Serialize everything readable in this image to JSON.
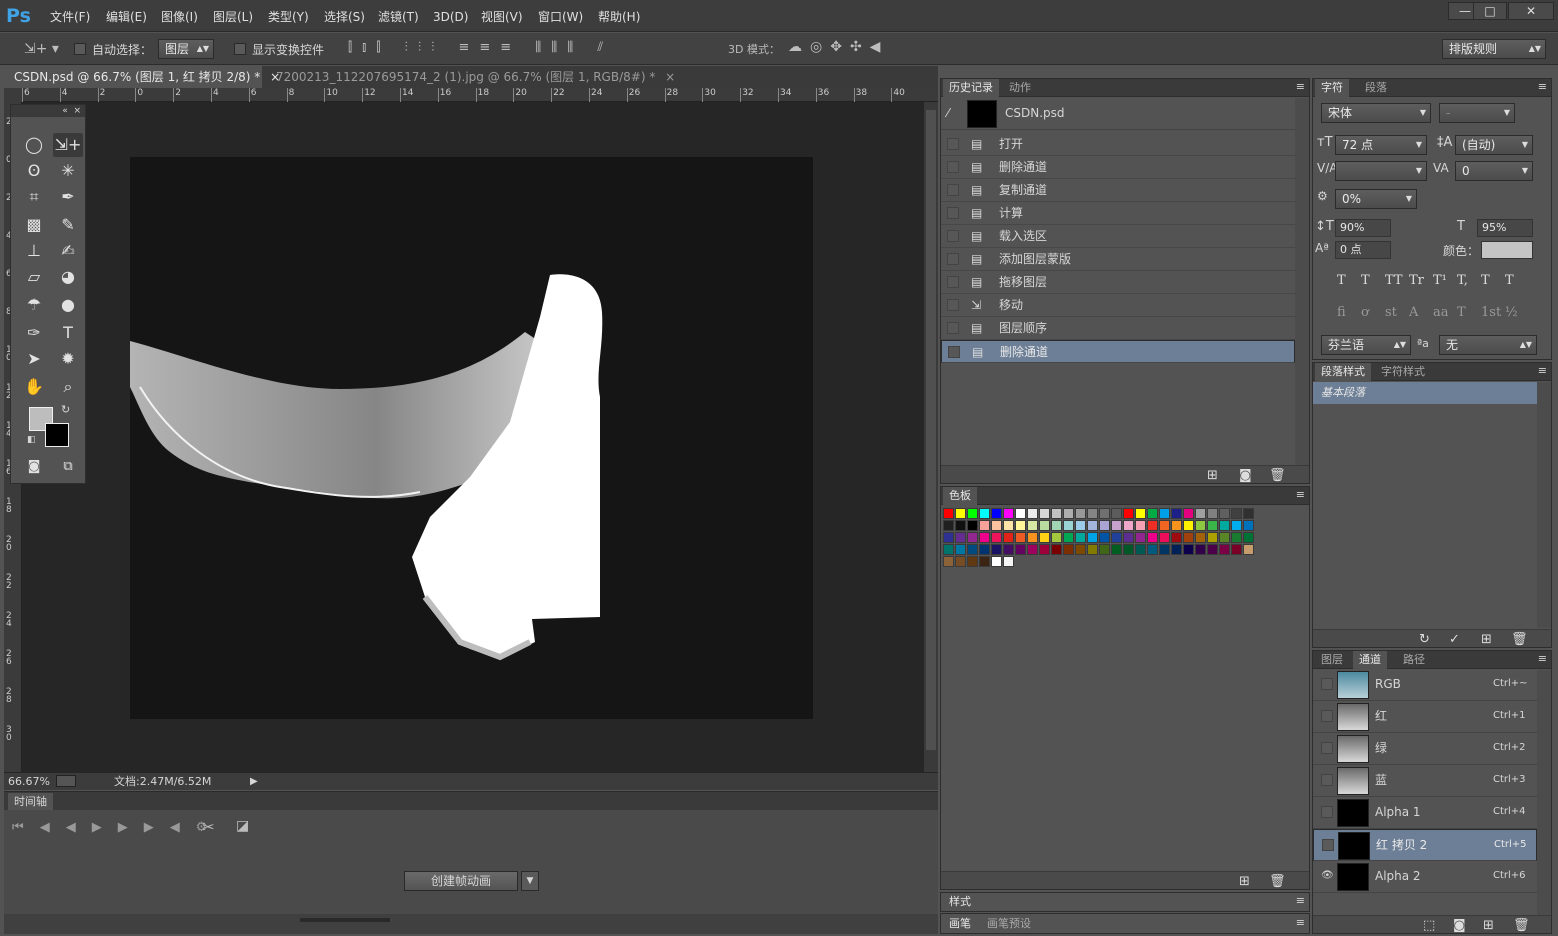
{
  "app": {
    "logo": "Ps"
  },
  "menu": [
    "文件(F)",
    "编辑(E)",
    "图像(I)",
    "图层(L)",
    "类型(Y)",
    "选择(S)",
    "滤镜(T)",
    "3D(D)",
    "视图(V)",
    "窗口(W)",
    "帮助(H)"
  ],
  "window_buttons": [
    "—",
    "□",
    "✕"
  ],
  "options": {
    "auto_select_label": "自动选择：",
    "auto_select_value": "图层",
    "show_transform_label": "显示变换控件",
    "mode_3d_label": "3D 模式：",
    "workspace": "排版规则"
  },
  "tabs": [
    {
      "label": "CSDN.psd @ 66.7% (图层 1, 红 拷贝 2/8) *"
    },
    {
      "label": "7200213_112207695174_2 (1).jpg @ 66.7% (图层 1, RGB/8#) *"
    }
  ],
  "ruler": {
    "h": [
      "6",
      "4",
      "2",
      "0",
      "2",
      "4",
      "6",
      "8",
      "10",
      "12",
      "14",
      "16",
      "18",
      "20",
      "22",
      "24",
      "26",
      "28",
      "30",
      "32",
      "34",
      "36",
      "38",
      "40"
    ],
    "v": [
      "2",
      "0",
      "2",
      "4",
      "6",
      "8",
      "1\n0",
      "1\n2",
      "1\n4",
      "1\n6",
      "1\n8",
      "2\n0",
      "2\n2",
      "2\n4",
      "2\n6",
      "2\n8",
      "3\n0"
    ]
  },
  "status": {
    "zoom": "66.67%",
    "doc": "文档:2.47M/6.52M"
  },
  "timeline": {
    "title": "时间轴",
    "create_button": "创建帧动画"
  },
  "history": {
    "tabs": [
      "历史记录",
      "动作"
    ],
    "snapshot": "CSDN.psd",
    "items": [
      "打开",
      "删除通道",
      "复制通道",
      "计算",
      "载入选区",
      "添加图层蒙版",
      "拖移图层",
      "移动",
      "图层顺序",
      "删除通道"
    ],
    "selected_index": 9
  },
  "swatches": {
    "title": "色板"
  },
  "styles": {
    "title": "样式"
  },
  "brushes": {
    "tabs": [
      "画笔",
      "画笔预设"
    ]
  },
  "character": {
    "tabs": [
      "字符",
      "段落"
    ],
    "font": "宋体",
    "style": "-",
    "size": "72 点",
    "leading": "(自动)",
    "kerning": "",
    "tracking": "0",
    "scale_pct": "0%",
    "vscale": "90%",
    "hscale": "95%",
    "baseline": "0 点",
    "color_label": "颜色：",
    "language": "芬兰语",
    "aa_label": "ªa",
    "aa_value": "无",
    "style_buttons": [
      "T",
      "T",
      "TT",
      "Tr",
      "T¹",
      "T,",
      "T",
      "T"
    ],
    "ot_buttons": [
      "fi",
      "ơ",
      "st",
      "A",
      "aa",
      "T",
      "1st",
      "½"
    ]
  },
  "para_styles": {
    "tabs": [
      "段落样式",
      "字符样式"
    ],
    "items": [
      "基本段落"
    ]
  },
  "channels": {
    "tabs": [
      "图层",
      "通道",
      "路径"
    ],
    "rows": [
      {
        "name": "RGB",
        "shortcut": "Ctrl+~"
      },
      {
        "name": "红",
        "shortcut": "Ctrl+1"
      },
      {
        "name": "绿",
        "shortcut": "Ctrl+2"
      },
      {
        "name": "蓝",
        "shortcut": "Ctrl+3"
      },
      {
        "name": "Alpha 1",
        "shortcut": "Ctrl+4"
      },
      {
        "name": "红 拷贝 2",
        "shortcut": "Ctrl+5"
      },
      {
        "name": "Alpha 2",
        "shortcut": "Ctrl+6"
      }
    ],
    "selected_index": 5,
    "visible_index": 6
  },
  "colors": {
    "swatches": [
      [
        "#ff0000",
        "#ffff00",
        "#00ff00",
        "#00ffff",
        "#0000ff",
        "#ff00ff",
        "#ffffff",
        "#ebebeb",
        "#d6d6d6",
        "#c2c2c2",
        "#adadad",
        "#999999",
        "#858585",
        "#707070",
        "#5c5c5c",
        "#ff0000",
        "#ffff00",
        "#00aa44",
        "#00a0e9",
        "#1d2088",
        "#e4007f",
        "#a0a0a0",
        "#808080",
        "#606060",
        "#404040",
        "#303030"
      ],
      [
        "#202020",
        "#101010",
        "#000000",
        "#f7a19a",
        "#fbc2a0",
        "#fde3a7",
        "#fff799",
        "#d7e8a4",
        "#b8dba0",
        "#a2d5b4",
        "#99d3d3",
        "#9ccbea",
        "#a2b5dd",
        "#a9a4d2",
        "#c7a2cc",
        "#eea7c9",
        "#f4a1b5",
        "#ee2e24",
        "#f16522",
        "#f7941d",
        "#fff200",
        "#8dc63f",
        "#39b54a",
        "#00a99d",
        "#00aeef",
        "#0072bc"
      ],
      [
        "#2e3192",
        "#662d91",
        "#92278f",
        "#ec008c",
        "#ed145b",
        "#e2231a",
        "#ee5a24",
        "#f8931f",
        "#fcd116",
        "#a3c73d",
        "#00a651",
        "#00a89c",
        "#00a4e4",
        "#0054a6",
        "#21409a",
        "#5c2e91",
        "#91268f",
        "#ec008b",
        "#ec0e5b",
        "#9e0b0f",
        "#a0410d",
        "#a36209",
        "#aba000",
        "#598527",
        "#197b30",
        "#007236"
      ],
      [
        "#00746b",
        "#0076a3",
        "#004a80",
        "#003471",
        "#1b1464",
        "#440e62",
        "#630460",
        "#9e005d",
        "#9e0039",
        "#790000",
        "#7b2e00",
        "#7d4900",
        "#827b00",
        "#406618",
        "#005e20",
        "#005826",
        "#005952",
        "#005b7f",
        "#003663",
        "#002157",
        "#0d004c",
        "#32004b",
        "#4b0049",
        "#7b0046",
        "#7a0026",
        "#c69c6d"
      ],
      [
        "#8c6239",
        "#754c24",
        "#603913",
        "#3c2415",
        "#ffffff",
        "#f5f5f5"
      ]
    ]
  }
}
